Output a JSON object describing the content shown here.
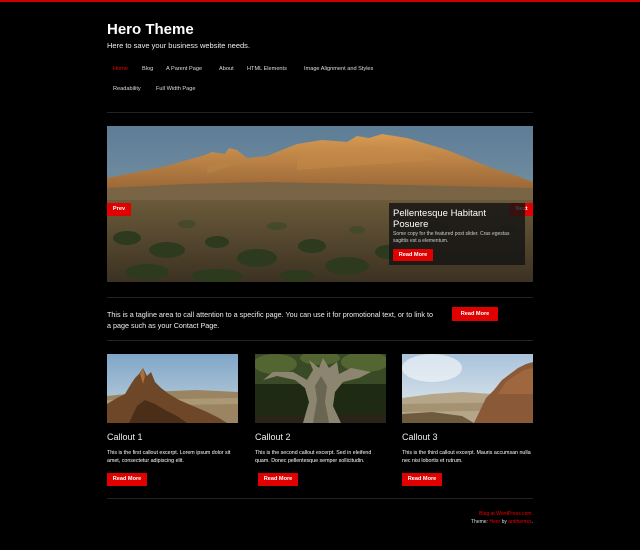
{
  "site": {
    "title": "Hero Theme",
    "description": "Here to save your business website needs."
  },
  "nav": {
    "items": [
      {
        "label": "Home",
        "active": true
      },
      {
        "label": "Blog"
      },
      {
        "label": "A Parent Page"
      },
      {
        "label": "About"
      },
      {
        "label": "HTML Elements"
      },
      {
        "label": "Image Alignment and Styles"
      },
      {
        "label": "Readability"
      },
      {
        "label": "Full Width Page"
      }
    ]
  },
  "slider": {
    "prev_label": "Prev",
    "next_label": "Next",
    "caption_title": "Pellentesque Habitant Posuere",
    "caption_text": "Some copy for the featured post slider. Cras egestas sagittis est a elementum.",
    "read_more_label": "Read More"
  },
  "tagline": {
    "text": "This is a tagline area to call attention to a specific page. You can use it for promotional text, or to link to a page such as your Contact Page.",
    "button_label": "Read More"
  },
  "callouts": [
    {
      "title": "Callout 1",
      "text": "This is the first callout excerpt. Lorem ipsum dolor sit amet, consectetur adipiscing elit.",
      "button_label": "Read More"
    },
    {
      "title": "Callout 2",
      "text": "This is the second callout excerpt. Sed in eleifend quam. Donec pellentesque semper sollicitudin.",
      "button_label": "Read More"
    },
    {
      "title": "Callout 3",
      "text": "This is the third callout excerpt. Mauris accumsan nulla nec nisi lobortis et rutrum.",
      "button_label": "Read More"
    }
  ],
  "footer": {
    "blog_link": "Blog at WordPress.com.",
    "theme_prefix": "Theme: ",
    "theme_name": "Hero",
    "by_text": " by ",
    "author": "antthemes",
    "period": "."
  },
  "colors": {
    "accent": "#e00000",
    "background": "#000000",
    "text": "#ffffff"
  }
}
